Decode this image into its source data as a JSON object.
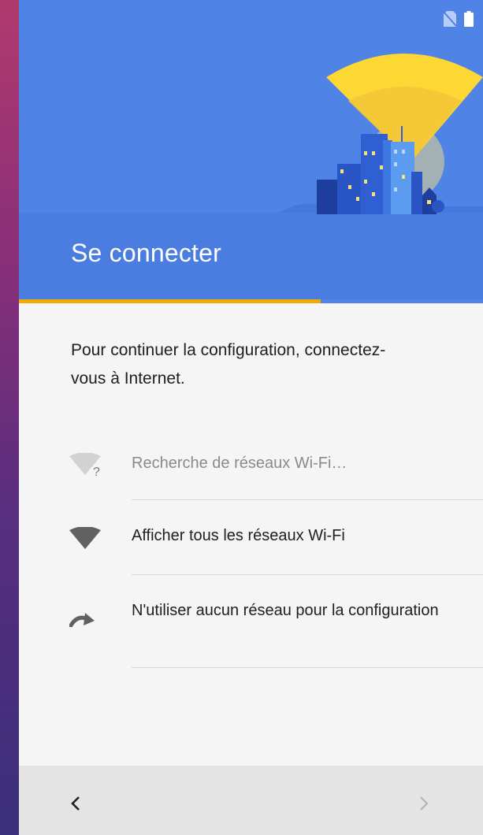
{
  "header": {
    "title": "Se connecter",
    "progress": 0.65,
    "colors": {
      "hero_bg": "#4f83e6",
      "progress": "#f2a900"
    }
  },
  "status_bar": {
    "icons": [
      "no-sim-icon",
      "battery-icon"
    ]
  },
  "content": {
    "intro": "Pour continuer la configuration, connectez-vous à Internet.",
    "options": [
      {
        "label": "Recherche de réseaux Wi-Fi…",
        "icon": "wifi-searching-icon",
        "state": "disabled"
      },
      {
        "label": "Afficher tous les réseaux Wi-Fi",
        "icon": "wifi-icon",
        "state": "enabled"
      },
      {
        "label": "N'utiliser aucun réseau pour la configuration",
        "icon": "skip-arrow-icon",
        "state": "enabled"
      }
    ]
  },
  "navigation": {
    "back_icon": "chevron-left-icon",
    "next_icon": "chevron-right-icon",
    "next_enabled": false
  }
}
